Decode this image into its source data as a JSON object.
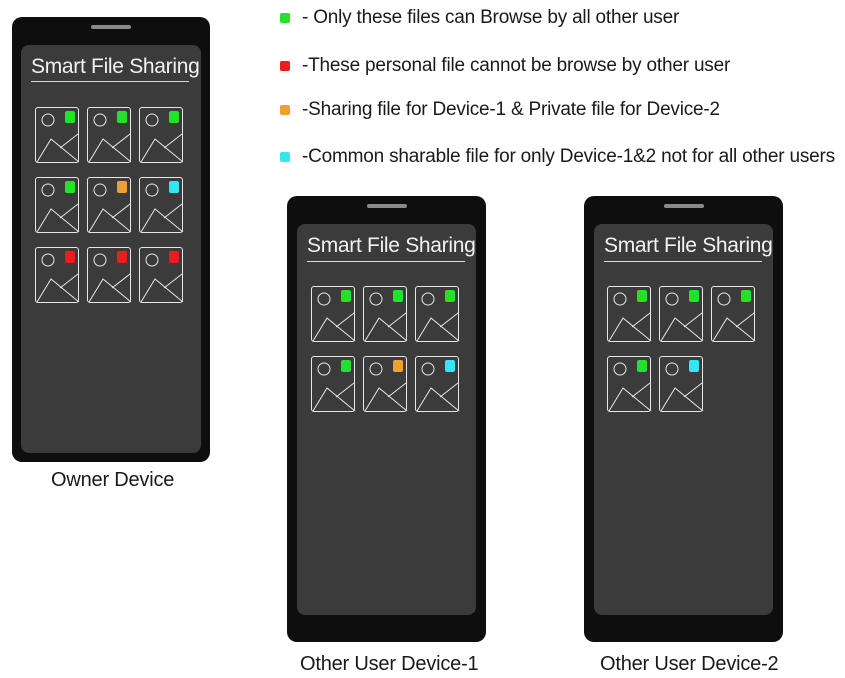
{
  "legend": [
    {
      "text": "- Only these files can Browse by all other user",
      "color": "#22e22c",
      "meaning": "public"
    },
    {
      "text": "-These personal file cannot be browse by other user",
      "color": "#ee1c1c",
      "meaning": "private"
    },
    {
      "text": "-Sharing file for Device-1 & Private file for Device-2",
      "color": "#f0a032",
      "meaning": "device-1 only"
    },
    {
      "text": "-Common sharable file for only Device-1&2 not for all other users",
      "color": "#33e6f5",
      "meaning": "device-1 and 2"
    }
  ],
  "devices": [
    {
      "id": "owner",
      "app_title": "Smart File Sharing",
      "label": "Owner Device",
      "files": [
        {
          "badge": "green"
        },
        {
          "badge": "green"
        },
        {
          "badge": "green"
        },
        {
          "badge": "green"
        },
        {
          "badge": "orange"
        },
        {
          "badge": "cyan"
        },
        {
          "badge": "red"
        },
        {
          "badge": "red"
        },
        {
          "badge": "red"
        }
      ]
    },
    {
      "id": "device-1",
      "app_title": "Smart File Sharing",
      "label": "Other User Device-1",
      "files": [
        {
          "badge": "green"
        },
        {
          "badge": "green"
        },
        {
          "badge": "green"
        },
        {
          "badge": "green"
        },
        {
          "badge": "orange"
        },
        {
          "badge": "cyan"
        }
      ]
    },
    {
      "id": "device-2",
      "app_title": "Smart File Sharing",
      "label": "Other User Device-2",
      "files": [
        {
          "badge": "green"
        },
        {
          "badge": "green"
        },
        {
          "badge": "green"
        },
        {
          "badge": "green"
        },
        {
          "badge": "cyan"
        }
      ]
    }
  ],
  "badge_colors": {
    "green": "#22e22c",
    "red": "#ee1c1c",
    "orange": "#f0a032",
    "cyan": "#33e6f5"
  }
}
